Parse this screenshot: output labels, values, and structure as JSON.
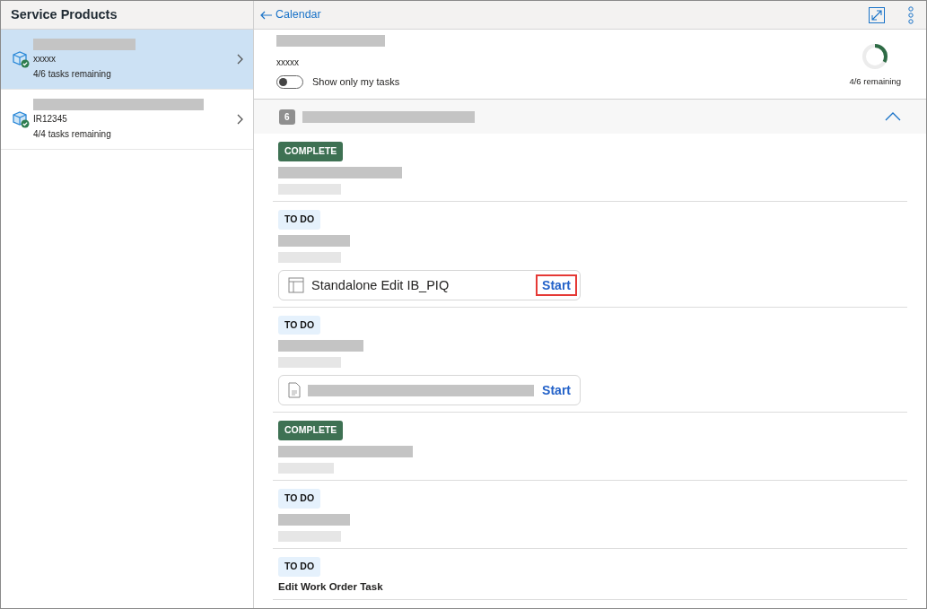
{
  "sidebar": {
    "title": "Service Products",
    "items": [
      {
        "subtitle": "xxxxx",
        "tasks": "4/6 tasks remaining",
        "selected": true
      },
      {
        "subtitle": "IR12345",
        "tasks": "4/4 tasks remaining",
        "selected": false
      }
    ]
  },
  "header": {
    "back": "Calendar"
  },
  "summary": {
    "subtitle": "xxxxx",
    "toggle": {
      "label": "Show only my tasks",
      "on": false
    },
    "progress": {
      "level": 0.33,
      "label": "4/6 remaining"
    }
  },
  "group": {
    "count": "6",
    "expanded": true
  },
  "tasks": [
    {
      "status": "COMPLETE",
      "kind": "complete"
    },
    {
      "status": "TO DO",
      "kind": "todo",
      "attachment": {
        "kind": "form",
        "title": "Standalone Edit IB_PIQ",
        "action": "Start",
        "highlighted": true
      }
    },
    {
      "status": "TO DO",
      "kind": "todo",
      "attachment": {
        "kind": "document",
        "action": "Start",
        "highlighted": false
      }
    },
    {
      "status": "COMPLETE",
      "kind": "complete"
    },
    {
      "status": "TO DO",
      "kind": "todo"
    },
    {
      "status": "TO DO",
      "kind": "todo",
      "title": "Edit Work Order Task"
    }
  ]
}
